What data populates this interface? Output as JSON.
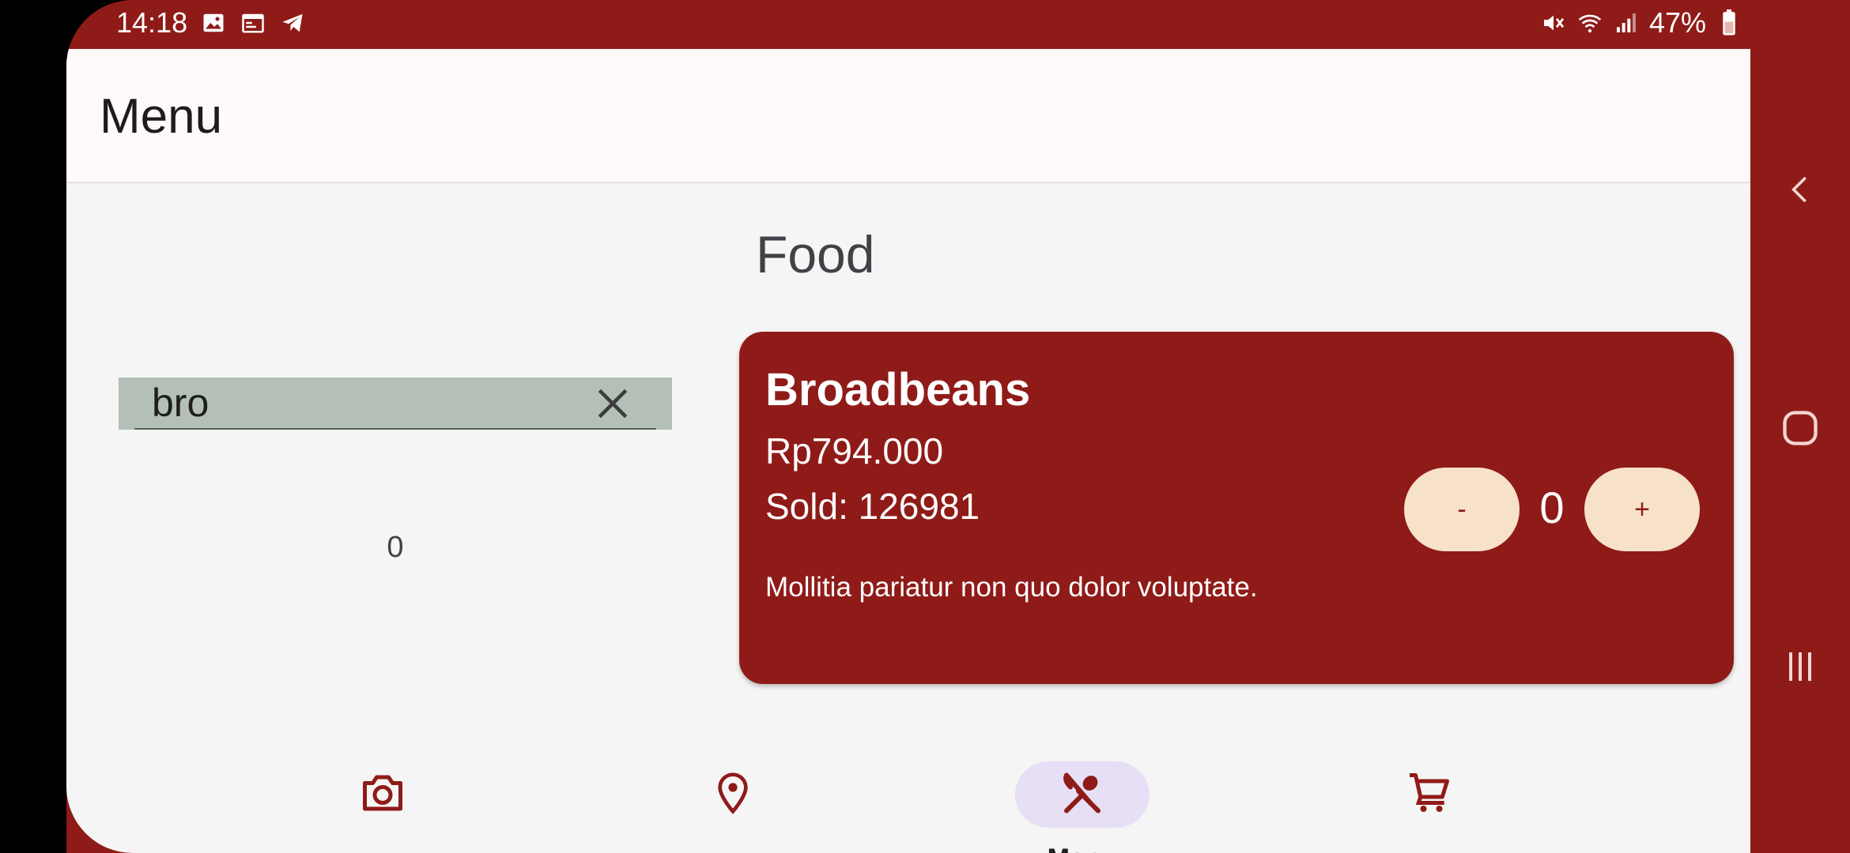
{
  "status_bar": {
    "time": "14:18",
    "left_icons": [
      "image-icon",
      "calendar-icon",
      "telegram-icon"
    ],
    "right_icons": [
      "mute-icon",
      "wifi-icon",
      "signal-icon"
    ],
    "battery": "47%"
  },
  "app_bar": {
    "title": "Menu"
  },
  "section": {
    "title": "Food"
  },
  "search": {
    "value": "bro"
  },
  "counter": "0",
  "item": {
    "name": "Broadbeans",
    "price": "Rp794.000",
    "sold": "Sold: 126981",
    "description": "Mollitia pariatur non quo dolor voluptate.",
    "minus_label": "-",
    "quantity": "0",
    "plus_label": "+"
  },
  "bottom_nav": {
    "items": [
      {
        "icon": "camera-icon",
        "label": ""
      },
      {
        "icon": "location-pin-icon",
        "label": ""
      },
      {
        "icon": "restaurant-icon",
        "label": "Menu",
        "active": true
      },
      {
        "icon": "cart-icon",
        "label": ""
      }
    ]
  },
  "colors": {
    "primary": "#8f1b18",
    "background": "#f5f5f5",
    "appbar": "#fefafa",
    "button": "#f7e1c9",
    "search_fill": "#b3bfb7",
    "nav_active": "#e7dff5"
  }
}
